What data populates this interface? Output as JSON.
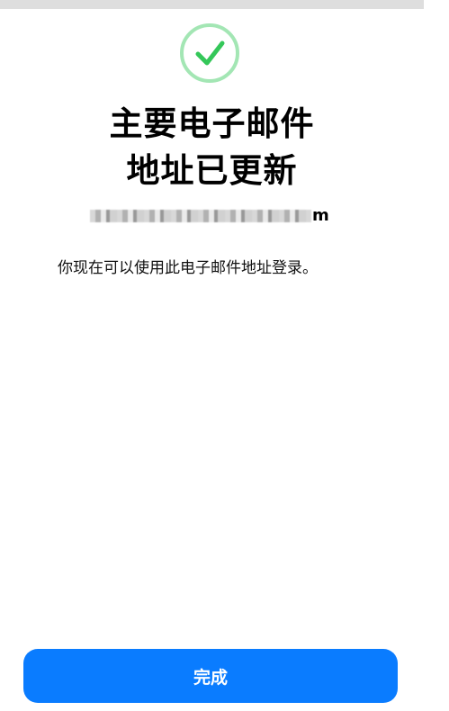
{
  "status": {
    "icon": "checkmark-circle-icon",
    "color": "#34c759"
  },
  "title_lines": [
    "主要电子邮件",
    "地址已更新"
  ],
  "email": {
    "visible_suffix": "m"
  },
  "message": "你现在可以使用此电子邮件地址登录。",
  "button": {
    "label": "完成",
    "color": "#0a7cff"
  },
  "colors": {
    "accent": "#0a7cff",
    "success": "#34c759",
    "text": "#000000",
    "background": "#ffffff"
  }
}
